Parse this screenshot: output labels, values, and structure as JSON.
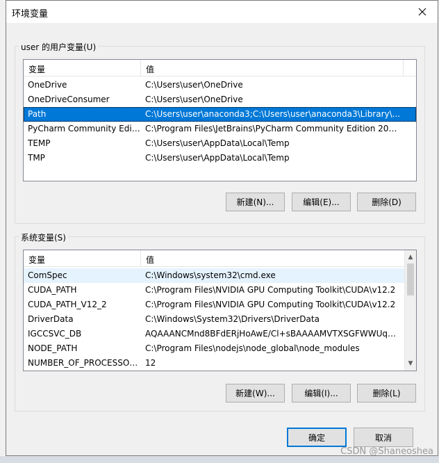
{
  "window": {
    "title": "环境变量"
  },
  "user_group": {
    "label": "user 的用户变量(U)",
    "columns": [
      "变量",
      "值"
    ],
    "rows": [
      {
        "name": "OneDrive",
        "value": "C:\\Users\\user\\OneDrive"
      },
      {
        "name": "OneDriveConsumer",
        "value": "C:\\Users\\user\\OneDrive"
      },
      {
        "name": "Path",
        "value": "C:\\Users\\user\\anaconda3;C:\\Users\\user\\anaconda3\\Library\\..."
      },
      {
        "name": "PyCharm Community Editi...",
        "value": "C:\\Program Files\\JetBrains\\PyCharm Community Edition 2023...."
      },
      {
        "name": "TEMP",
        "value": "C:\\Users\\user\\AppData\\Local\\Temp"
      },
      {
        "name": "TMP",
        "value": "C:\\Users\\user\\AppData\\Local\\Temp"
      }
    ],
    "selected_row": "Path",
    "buttons": {
      "new": "新建(N)...",
      "edit": "编辑(E)...",
      "delete": "删除(D)"
    }
  },
  "system_group": {
    "label": "系统变量(S)",
    "columns": [
      "变量",
      "值"
    ],
    "rows": [
      {
        "name": "ComSpec",
        "value": "C:\\Windows\\system32\\cmd.exe"
      },
      {
        "name": "CUDA_PATH",
        "value": "C:\\Program Files\\NVIDIA GPU Computing Toolkit\\CUDA\\v12.2"
      },
      {
        "name": "CUDA_PATH_V12_2",
        "value": "C:\\Program Files\\NVIDIA GPU Computing Toolkit\\CUDA\\v12.2"
      },
      {
        "name": "DriverData",
        "value": "C:\\Windows\\System32\\Drivers\\DriverData"
      },
      {
        "name": "IGCCSVC_DB",
        "value": "AQAAANCMnd8BFdERjHoAwE/Cl+sBAAAAMVTXSGFWWUq4..."
      },
      {
        "name": "NODE_PATH",
        "value": "C:\\Program Files\\nodejs\\node_global\\node_modules"
      },
      {
        "name": "NUMBER_OF_PROCESSORS",
        "value": "12"
      }
    ],
    "hovered_row": "ComSpec",
    "buttons": {
      "new": "新建(W)...",
      "edit": "编辑(I)...",
      "delete": "删除(L)"
    }
  },
  "footer": {
    "ok": "确定",
    "cancel": "取消"
  },
  "watermark": "CSDN @Shaneoshea",
  "icons": {
    "close": "close-icon",
    "scroll_up": "chevron-up-icon",
    "scroll_down": "chevron-down-icon"
  },
  "colors": {
    "selection": "#0078d7",
    "hover": "#e5f3ff",
    "primary_border": "#0078d7"
  }
}
